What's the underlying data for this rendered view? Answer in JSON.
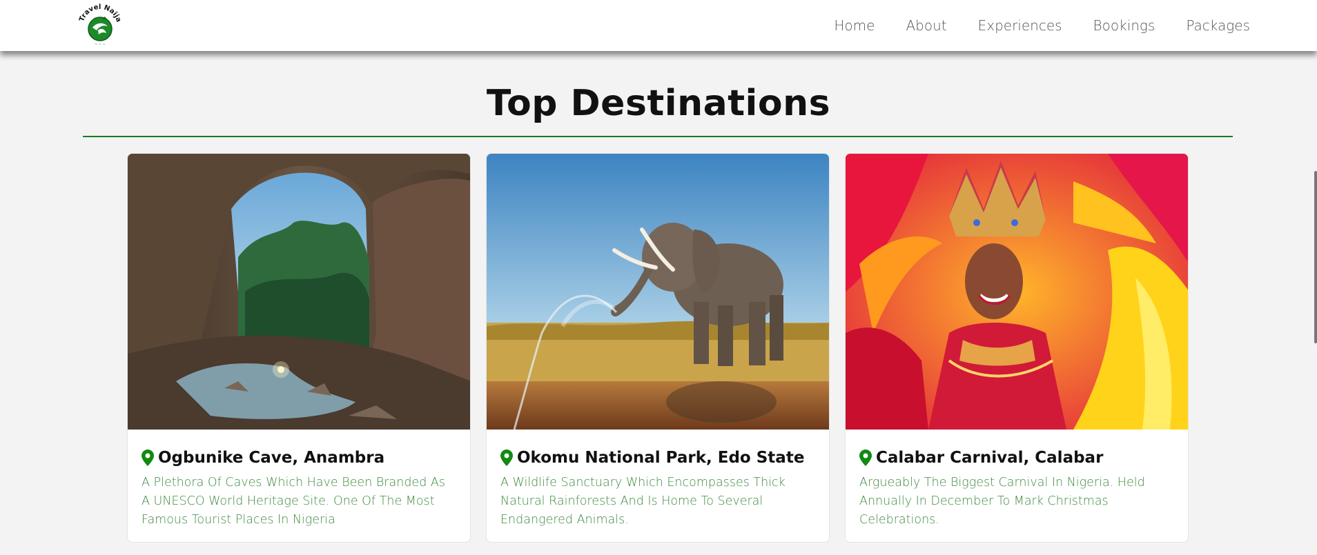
{
  "header": {
    "logo_text": "Travel Naija",
    "nav": [
      {
        "label": "Home"
      },
      {
        "label": "About"
      },
      {
        "label": "Experiences"
      },
      {
        "label": "Bookings"
      },
      {
        "label": "Packages"
      }
    ]
  },
  "section": {
    "title": "Top Destinations"
  },
  "cards": [
    {
      "title": "Ogbunike Cave, Anambra",
      "description": "A Plethora Of Caves Which Have Been Branded As A UNESCO World Heritage Site. One Of The Most Famous Tourist Places In Nigeria",
      "image": "cave-photo",
      "icon": "location-pin-icon"
    },
    {
      "title": "Okomu National Park, Edo State",
      "description": "A Wildlife Sanctuary Which Encompasses Thick Natural Rainforests And Is Home To Several Endangered Animals.",
      "image": "elephant-photo",
      "icon": "location-pin-icon"
    },
    {
      "title": "Calabar Carnival, Calabar",
      "description": "Argueably The Biggest Carnival In Nigeria. Held Annually In December To Mark Christmas Celebrations.",
      "image": "carnival-photo",
      "icon": "location-pin-icon"
    }
  ],
  "colors": {
    "accent_green": "#1a7a1a",
    "description_green": "#3f8a3f",
    "background": "#f3f3f3"
  }
}
